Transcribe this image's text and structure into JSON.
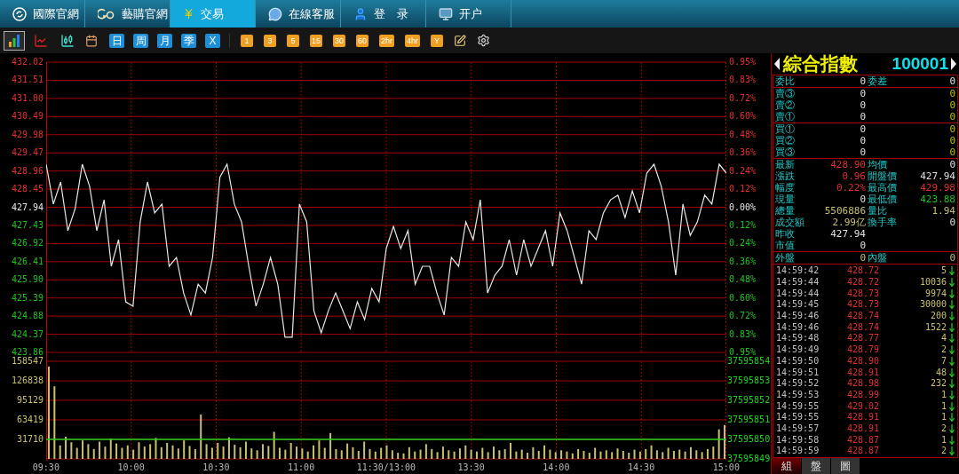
{
  "nav_tabs": [
    {
      "label": "國際官網",
      "selected": false
    },
    {
      "label": "藝購官網",
      "selected": false
    },
    {
      "label": "交易",
      "selected": true
    },
    {
      "label": "在線客服",
      "selected": false
    },
    {
      "label": "登　录",
      "selected": false
    },
    {
      "label": "开户",
      "selected": false
    }
  ],
  "toolbar": {
    "chart_types": [
      {
        "selected": true
      },
      {
        "selected": false
      },
      {
        "selected": false
      }
    ],
    "periods": [
      "日",
      "周",
      "月",
      "季",
      "X"
    ],
    "minutes": [
      "1",
      "3",
      "5",
      "15",
      "30",
      "60",
      "2hr",
      "4hr",
      "Y"
    ]
  },
  "price_chart": {
    "chart_data": {
      "type": "line",
      "grid": true,
      "ylim": [
        423.86,
        432.02
      ],
      "yticks": [
        {
          "value": 432.02,
          "label": "432.02"
        },
        {
          "value": 431.51,
          "label": "431.51"
        },
        {
          "value": 431.0,
          "label": "431.00"
        },
        {
          "value": 430.49,
          "label": "430.49"
        },
        {
          "value": 429.98,
          "label": "429.98"
        },
        {
          "value": 429.47,
          "label": "429.47"
        },
        {
          "value": 428.96,
          "label": "428.96"
        },
        {
          "value": 428.45,
          "label": "428.45"
        },
        {
          "value": 427.94,
          "label": "427.94"
        },
        {
          "value": 427.43,
          "label": "427.43"
        },
        {
          "value": 426.92,
          "label": "426.92"
        },
        {
          "value": 426.41,
          "label": "426.41"
        },
        {
          "value": 425.9,
          "label": "425.90"
        },
        {
          "value": 425.39,
          "label": "425.39"
        },
        {
          "value": 424.88,
          "label": "424.88"
        },
        {
          "value": 424.37,
          "label": "424.37"
        },
        {
          "value": 423.86,
          "label": "423.86"
        }
      ],
      "series": [
        {
          "color": "#e8e8e8",
          "values": [
            429.15,
            428.03,
            428.65,
            427.28,
            427.9,
            429.15,
            428.53,
            427.28,
            428.15,
            426.28,
            427.03,
            425.28,
            425.16,
            427.53,
            428.65,
            427.78,
            428.03,
            426.28,
            426.53,
            425.53,
            424.91,
            425.78,
            425.53,
            426.53,
            428.78,
            429.15,
            428.03,
            427.53,
            426.28,
            425.16,
            425.78,
            426.53,
            425.78,
            424.29,
            424.29,
            428.03,
            427.53,
            425.03,
            424.41,
            425.03,
            425.53,
            425.03,
            424.53,
            425.28,
            424.78,
            425.66,
            425.28,
            426.78,
            427.4,
            426.78,
            427.28,
            425.78,
            426.28,
            426.28,
            425.53,
            424.91,
            426.53,
            426.28,
            427.53,
            427.03,
            428.15,
            425.53,
            426.03,
            426.28,
            427.03,
            426.03,
            427.03,
            426.28,
            426.78,
            427.28,
            426.28,
            427.78,
            427.28,
            426.53,
            425.78,
            427.28,
            427.03,
            427.78,
            428.15,
            428.28,
            427.65,
            428.4,
            427.78,
            428.9,
            429.15,
            428.53,
            427.53,
            426.03,
            428.03,
            427.15,
            427.53,
            428.28,
            428.03,
            429.15,
            428.9
          ]
        }
      ]
    },
    "right_labels": [
      "0.95%",
      "0.83%",
      "0.72%",
      "0.60%",
      "0.48%",
      "0.36%",
      "0.24%",
      "0.12%",
      "0.00%",
      "0.12%",
      "0.24%",
      "0.36%",
      "0.48%",
      "0.60%",
      "0.72%",
      "0.83%",
      "0.95%"
    ]
  },
  "volume_chart": {
    "chart_data": {
      "type": "bar",
      "grid": true,
      "ylim": [
        0,
        158547
      ],
      "yticks": [
        {
          "value": 158547,
          "label": "158547"
        },
        {
          "value": 126838,
          "label": "126838"
        },
        {
          "value": 95129,
          "label": "95129"
        },
        {
          "value": 63419,
          "label": "63419"
        },
        {
          "value": 31710,
          "label": "31710"
        }
      ],
      "series": [
        {
          "color": "#c8c070",
          "values": [
            150000,
            118000,
            22000,
            36000,
            27000,
            18000,
            30000,
            24000,
            16000,
            28000,
            20000,
            33000,
            25000,
            18000,
            22000,
            15000,
            27000,
            20000,
            24000,
            34000,
            19000,
            26000,
            22000,
            17000,
            30000,
            21000,
            16000,
            72000,
            24000,
            18000,
            26000,
            20000,
            35000,
            23000,
            19000,
            28000,
            17000,
            14000,
            24000,
            21000,
            44000,
            18000,
            15000,
            26000,
            20000,
            17000,
            12000,
            22000,
            30000,
            18000,
            42000,
            16000,
            14000,
            25000,
            19000,
            13000,
            28000,
            16000,
            12000,
            18000,
            22000,
            14000,
            10000,
            9000,
            19000,
            12000,
            15000,
            24000,
            16000,
            11000,
            20000,
            14000,
            12000,
            17000,
            22000,
            15000,
            12000,
            18000,
            11000,
            20000,
            14000,
            16000,
            26000,
            12000,
            15000,
            10000,
            19000,
            13000,
            22000,
            15000,
            11000,
            14000,
            12000,
            9000,
            16000,
            13000,
            10000,
            18000,
            12000,
            14000,
            11000,
            17000,
            13000,
            10000,
            15000,
            12000,
            16000,
            22000,
            14000,
            11000,
            18000,
            13000,
            15000,
            12000,
            19000,
            14000,
            11000,
            16000,
            20000,
            48000,
            55000
          ]
        },
        {
          "type": "line",
          "color": "#20d020",
          "values": [
            31710,
            31710,
            31710,
            31710,
            31710,
            31710,
            31710,
            31710,
            31710,
            31710,
            31710,
            31710,
            31710,
            31710,
            31710,
            31710,
            31710,
            31710,
            31710,
            31710,
            31710,
            31710,
            31710,
            31710,
            31710,
            31710,
            31710,
            31710,
            31710,
            31710,
            31710,
            31710,
            31710,
            31710,
            31710,
            31710,
            31710,
            31710,
            31710,
            31710,
            31710,
            31710,
            31710,
            31710,
            31710,
            31710,
            31710,
            31710,
            31710,
            31710,
            31710,
            31710,
            31710,
            31710,
            31710,
            31710,
            31710,
            31710,
            31710,
            31710,
            31710,
            31710,
            31710,
            31710,
            31710,
            31710,
            31710,
            31710,
            31710,
            31710,
            31710,
            31710,
            31710,
            31710,
            31710,
            31710,
            31710,
            31710,
            31710,
            31710,
            31710,
            31710,
            31710,
            31710,
            31710,
            31710,
            31710,
            31710,
            31710,
            31710,
            31710,
            31710,
            31710,
            31710,
            31710,
            31710,
            31710,
            31710,
            31710,
            31710,
            31710,
            31710,
            31710,
            31710,
            31710,
            31710,
            31710,
            31710,
            31710,
            31710,
            31710,
            31710,
            31710,
            31710,
            31710,
            31710,
            31710,
            31710,
            31710,
            31710,
            31710
          ]
        }
      ]
    },
    "right_labels": [
      "37595854",
      "37595853",
      "37595852",
      "37595851",
      "37595850",
      "37595849"
    ]
  },
  "time_axis": [
    "09:30",
    "10:00",
    "10:30",
    "11:00",
    "11:30/13:00",
    "13:30",
    "14:00",
    "14:30",
    "15:00"
  ],
  "quote": {
    "name": "綜合指數",
    "code": "100001",
    "ratio_rows": [
      {
        "label": "委比",
        "value": "0",
        "label2": "委差",
        "value2": "0"
      }
    ],
    "sell_rows": [
      {
        "label": "賣③",
        "value": "0",
        "value2": "0"
      },
      {
        "label": "賣②",
        "value": "0",
        "value2": "0"
      },
      {
        "label": "賣①",
        "value": "0",
        "value2": "0"
      }
    ],
    "buy_rows": [
      {
        "label": "買①",
        "value": "0",
        "value2": "0"
      },
      {
        "label": "買②",
        "value": "0",
        "value2": "0"
      },
      {
        "label": "買③",
        "value": "0",
        "value2": "0"
      }
    ],
    "stats": [
      {
        "cells": [
          {
            "label": "最新",
            "value": "428.90",
            "color": "#e03030"
          },
          {
            "label": "均價",
            "value": "0"
          }
        ]
      },
      {
        "cells": [
          {
            "label": "漲跌",
            "value": "0.96",
            "color": "#e03030"
          },
          {
            "label": "開盤價",
            "value": "427.94"
          }
        ]
      },
      {
        "cells": [
          {
            "label": "幅度",
            "value": "0.22%",
            "color": "#e03030"
          },
          {
            "label": "最高價",
            "value": "429.98",
            "color": "#e03030"
          }
        ]
      },
      {
        "cells": [
          {
            "label": "現量",
            "value": "0"
          },
          {
            "label": "最低價",
            "value": "423.88",
            "color": "#20c020"
          }
        ]
      },
      {
        "cells": [
          {
            "label": "總量",
            "value": "5506886",
            "color": "#c8c070"
          },
          {
            "label": "量比",
            "value": "1.94",
            "color": "#c8c070"
          }
        ]
      },
      {
        "cells": [
          {
            "label": "成交額",
            "value": "2.99亿",
            "color": "#c8c070"
          },
          {
            "label": "換手率",
            "value": "0"
          }
        ]
      },
      {
        "cells": [
          {
            "label": "昨收",
            "value": "427.94"
          }
        ]
      },
      {
        "cells": [
          {
            "label": "市值",
            "value": "0"
          }
        ]
      }
    ],
    "flow": {
      "label": "外盤",
      "value": "0",
      "label2": "內盤",
      "value2": "0"
    }
  },
  "trades": [
    {
      "time": "14:59:42",
      "price": "428.72",
      "volume": "5",
      "kind": "down"
    },
    {
      "time": "14:59:44",
      "price": "428.72",
      "volume": "10036",
      "kind": "down"
    },
    {
      "time": "14:59:44",
      "price": "428.73",
      "volume": "9974",
      "kind": "down"
    },
    {
      "time": "14:59:45",
      "price": "428.73",
      "volume": "30000",
      "kind": "down"
    },
    {
      "time": "14:59:46",
      "price": "428.74",
      "volume": "200",
      "kind": "down"
    },
    {
      "time": "14:59:46",
      "price": "428.74",
      "volume": "1522",
      "kind": "down"
    },
    {
      "time": "14:59:48",
      "price": "428.77",
      "volume": "4",
      "kind": "down"
    },
    {
      "time": "14:59:49",
      "price": "428.79",
      "volume": "2",
      "kind": "down"
    },
    {
      "time": "14:59:50",
      "price": "428.90",
      "volume": "7",
      "kind": "down"
    },
    {
      "time": "14:59:51",
      "price": "428.91",
      "volume": "48",
      "kind": "down"
    },
    {
      "time": "14:59:52",
      "price": "428.98",
      "volume": "232",
      "kind": "down"
    },
    {
      "time": "14:59:53",
      "price": "428.99",
      "volume": "1",
      "kind": "down"
    },
    {
      "time": "14:59:55",
      "price": "429.02",
      "volume": "1",
      "kind": "down"
    },
    {
      "time": "14:59:55",
      "price": "428.91",
      "volume": "1",
      "kind": "down"
    },
    {
      "time": "14:59:57",
      "price": "428.91",
      "volume": "2",
      "kind": "down"
    },
    {
      "time": "14:59:58",
      "price": "428.87",
      "volume": "1",
      "kind": "down"
    },
    {
      "time": "14:59:59",
      "price": "428.87",
      "volume": "2",
      "kind": "down"
    }
  ],
  "bottom_tabs": [
    {
      "label": "組",
      "selected": true
    },
    {
      "label": "盤",
      "selected": false
    },
    {
      "label": "圖",
      "selected": false
    }
  ]
}
